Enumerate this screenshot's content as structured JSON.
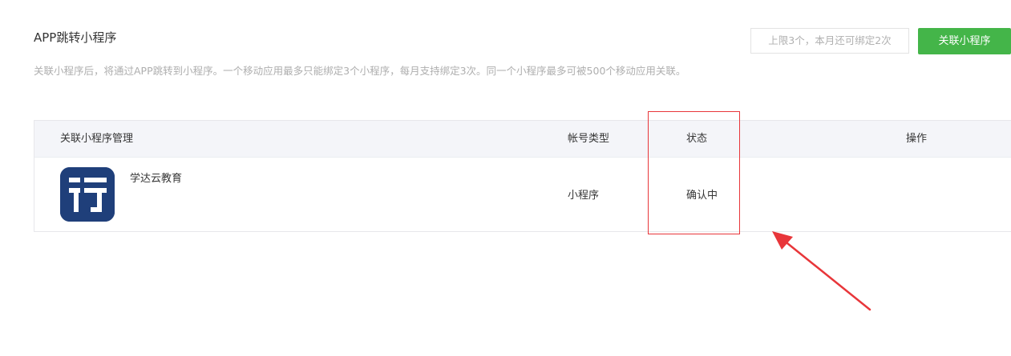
{
  "section": {
    "title": "APP跳转小程序",
    "description": "关联小程序后，将通过APP跳转到小程序。一个移动应用最多只能绑定3个小程序，每月支持绑定3次。同一个小程序最多可被500个移动应用关联。"
  },
  "toolbar": {
    "quota_text": "上限3个，本月还可绑定2次",
    "link_button_label": "关联小程序",
    "accent_color": "#44b549"
  },
  "table": {
    "headers": {
      "name": "关联小程序管理",
      "type": "帐号类型",
      "status": "状态",
      "ops": "操作"
    },
    "rows": [
      {
        "icon": "app-logo-icon",
        "name": "学达云教育",
        "type": "小程序",
        "status": "确认中"
      }
    ]
  },
  "annotation": {
    "color": "#e8363a"
  }
}
